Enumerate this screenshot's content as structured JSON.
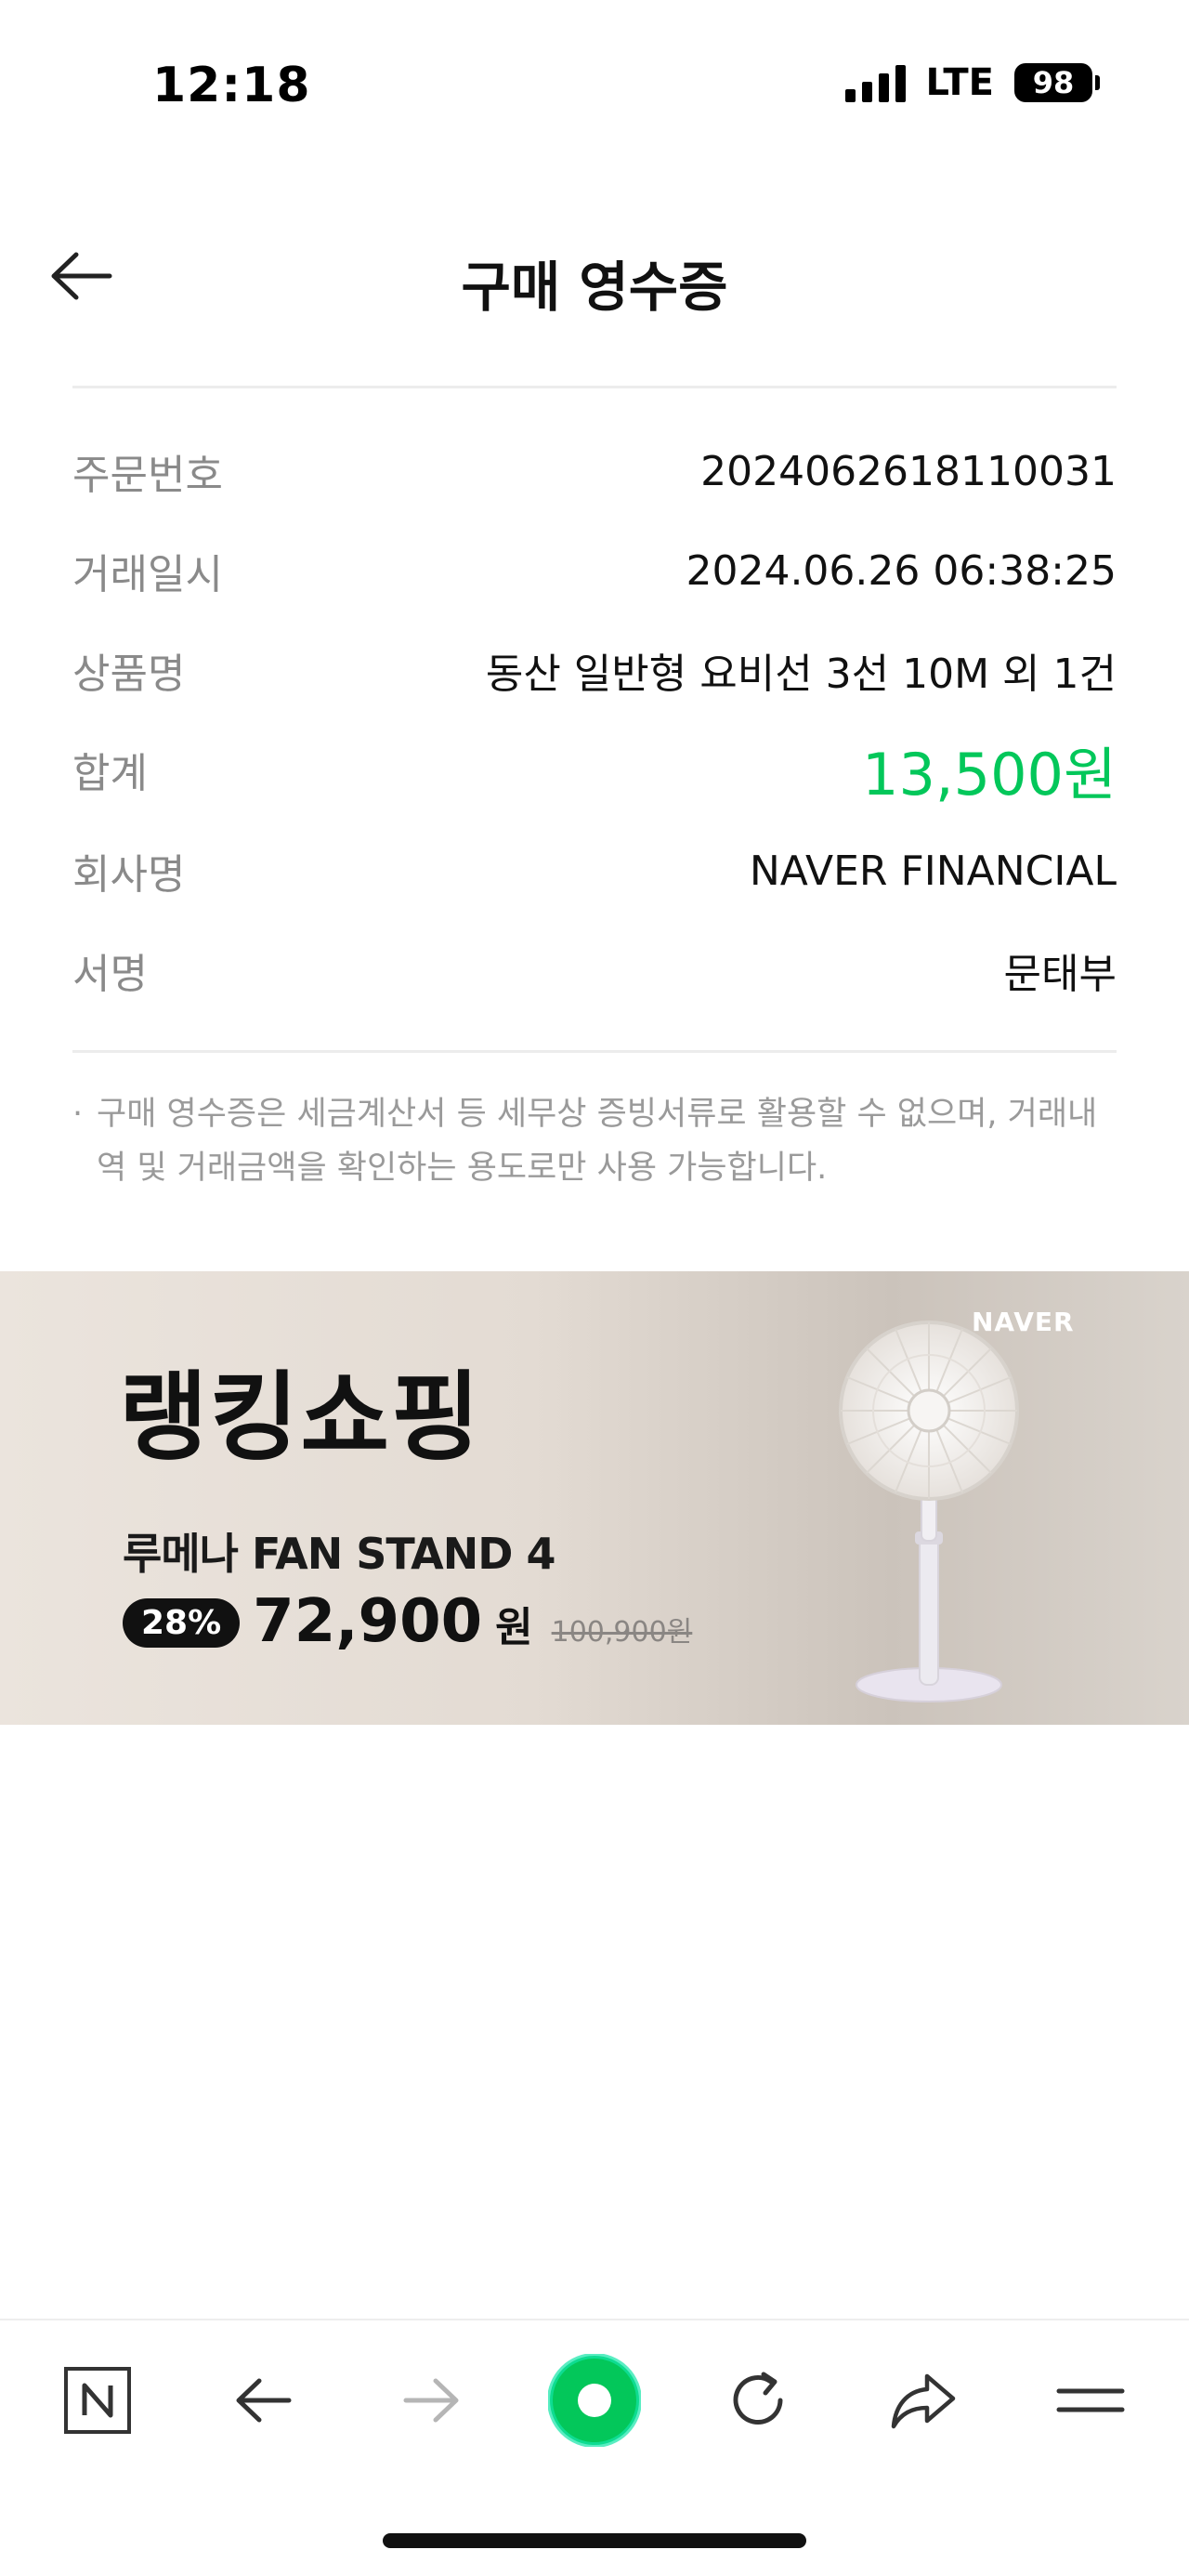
{
  "status_bar": {
    "time": "12:18",
    "network": "LTE",
    "battery": "98"
  },
  "header": {
    "title": "구매 영수증",
    "back_icon": "arrow-left-icon"
  },
  "receipt": {
    "rows": [
      {
        "label": "주문번호",
        "value": "2024062618110031"
      },
      {
        "label": "거래일시",
        "value": "2024.06.26 06:38:25"
      },
      {
        "label": "상품명",
        "value": "동산 일반형 요비선 3선 10M 외 1건"
      },
      {
        "label": "합계",
        "value": "13,500원"
      },
      {
        "label": "회사명",
        "value": "NAVER FINANCIAL"
      },
      {
        "label": "서명",
        "value": "문태부"
      }
    ],
    "total_color": "#03c75a"
  },
  "notice": {
    "bullet": "·",
    "text": "구매 영수증은 세금계산서 등 세무상 증빙서류로 활용할 수 없으며, 거래내역 및 거래금액을 확인하는 용도로만 사용 가능합니다."
  },
  "banner": {
    "title": "랭킹쇼핑",
    "brand": "NAVER",
    "product": "루메나 FAN STAND 4",
    "discount": "28%",
    "price": "72,900",
    "price_unit": "원",
    "original_price": "100,900원"
  },
  "toolbar": {
    "icons": [
      "naver-home-icon",
      "back-arrow-icon",
      "forward-arrow-icon",
      "green-dot-icon",
      "refresh-icon",
      "share-icon",
      "menu-icon"
    ],
    "forward_enabled": false,
    "accent_color": "#03c75a"
  }
}
